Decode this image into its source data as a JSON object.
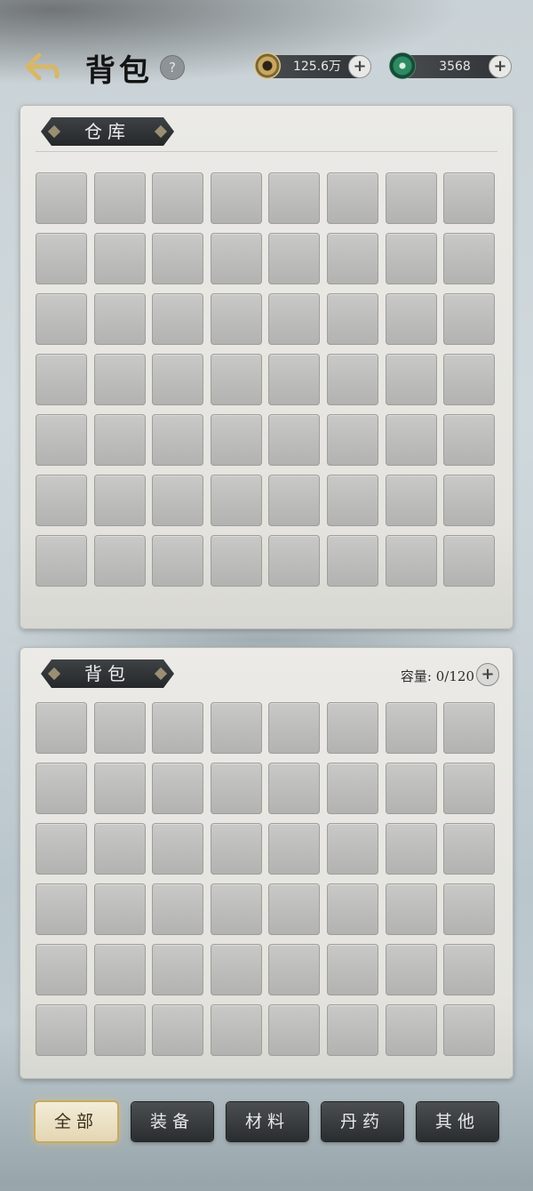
{
  "header": {
    "title": "背包",
    "help_label": "?",
    "coin": {
      "value": "125.6万",
      "icon": "coin-icon",
      "plus_label": "+"
    },
    "jade": {
      "value": "3568",
      "icon": "jade-icon",
      "plus_label": "+"
    }
  },
  "warehouse": {
    "title": "仓库"
  },
  "bag": {
    "title": "背包",
    "capacity_label": "容量:",
    "capacity_value": "0/120",
    "plus_label": "+"
  },
  "tabs": [
    {
      "label": "全部",
      "active": true
    },
    {
      "label": "装备",
      "active": false
    },
    {
      "label": "材料",
      "active": false
    },
    {
      "label": "丹药",
      "active": false
    },
    {
      "label": "其他",
      "active": false
    }
  ],
  "colors": {
    "accent_gold": "#c9a95f",
    "panel_bg": "#e8e7e2",
    "slot_bg": "#bdbdbb"
  }
}
